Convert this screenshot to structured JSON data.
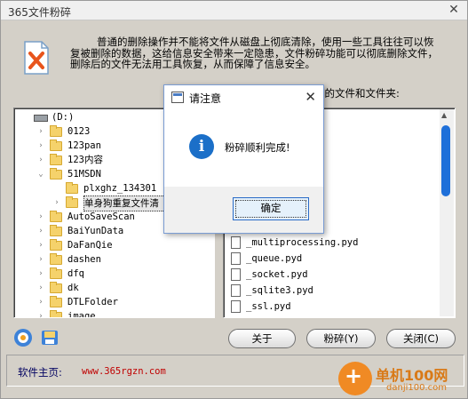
{
  "window": {
    "title": "365文件粉碎",
    "close_glyph": "✕"
  },
  "intro": {
    "lines": [
      "普通的删除操作并不能将文件从磁盘上彻底清除，使用一些工具往往可以恢",
      "复被删除的数据，这给信息安全带来一定隐患，文件粉碎功能可以彻底删除文件，",
      "删除后的文件无法用工具恢复，从而保障了信息安全。"
    ]
  },
  "tree": {
    "items": [
      {
        "label": "(D:)",
        "depth": 0,
        "expander": "",
        "icon": "drive"
      },
      {
        "label": "0123",
        "depth": 1,
        "expander": "›",
        "icon": "folder"
      },
      {
        "label": "123pan",
        "depth": 1,
        "expander": "›",
        "icon": "folder"
      },
      {
        "label": "123内容",
        "depth": 1,
        "expander": "›",
        "icon": "folder"
      },
      {
        "label": "51MSDN",
        "depth": 1,
        "expander": "⌄",
        "icon": "folder"
      },
      {
        "label": "plxghz_134301",
        "depth": 2,
        "expander": "",
        "icon": "folder"
      },
      {
        "label": "单身狗重复文件清",
        "depth": 2,
        "expander": "›",
        "icon": "folder",
        "selected": true
      },
      {
        "label": "AutoSaveScan",
        "depth": 1,
        "expander": "›",
        "icon": "folder"
      },
      {
        "label": "BaiYunData",
        "depth": 1,
        "expander": "›",
        "icon": "folder"
      },
      {
        "label": "DaFanQie",
        "depth": 1,
        "expander": "›",
        "icon": "folder"
      },
      {
        "label": "dashen",
        "depth": 1,
        "expander": "›",
        "icon": "folder"
      },
      {
        "label": "dfq",
        "depth": 1,
        "expander": "›",
        "icon": "folder"
      },
      {
        "label": "dk",
        "depth": 1,
        "expander": "›",
        "icon": "folder"
      },
      {
        "label": "DTLFolder",
        "depth": 1,
        "expander": "›",
        "icon": "folder"
      },
      {
        "label": "image",
        "depth": 1,
        "expander": "›",
        "icon": "folder"
      }
    ]
  },
  "right_panel": {
    "label": "要粉碎的文件和文件夹:",
    "files": [
      "_multiprocessing.pyd",
      "_queue.pyd",
      "_socket.pyd",
      "_sqlite3.pyd",
      "_ssl.pyd"
    ]
  },
  "buttons": {
    "about": "关于",
    "shred": "粉碎(Y)",
    "close": "关闭(C)"
  },
  "status": {
    "homepage_label": "软件主页:",
    "homepage_url": "www.365rgzn.com"
  },
  "watermark": {
    "name": "单机100网",
    "url": "danji100.com"
  },
  "dialog": {
    "title": "请注意",
    "close_glyph": "✕",
    "info_glyph": "i",
    "message": "粉碎顺利完成!",
    "ok_label": "确定"
  }
}
